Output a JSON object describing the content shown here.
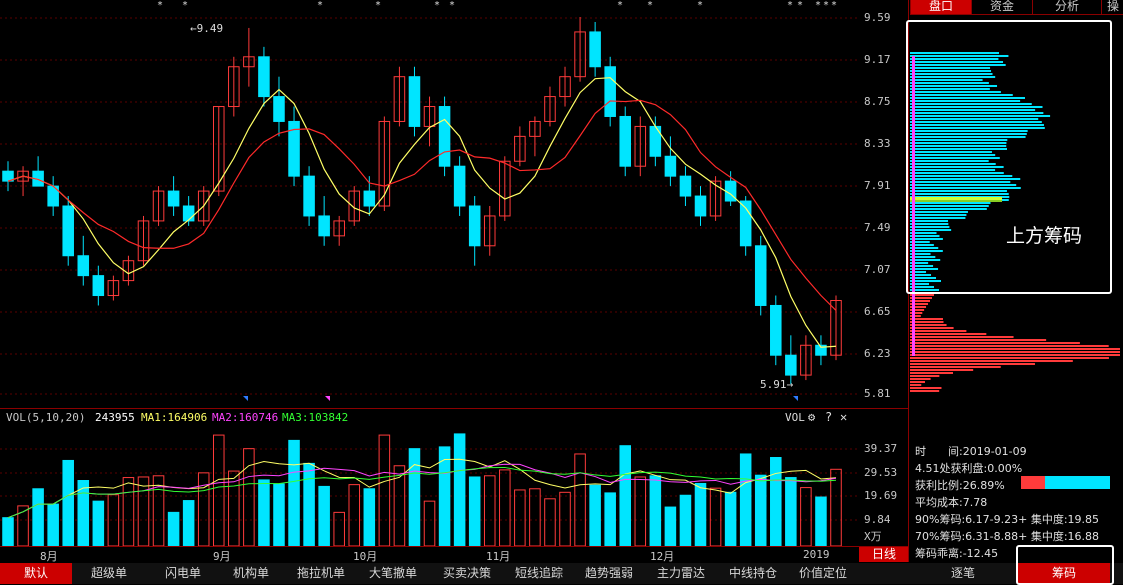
{
  "price_axis": [
    "9.59",
    "9.17",
    "8.75",
    "8.33",
    "7.91",
    "7.49",
    "7.07",
    "6.65",
    "6.23",
    "5.81"
  ],
  "annotations": {
    "high_label": "9.49",
    "low_label": "5.91"
  },
  "volume_header": {
    "indicator": "VOL(5,10,20)",
    "current": "243955",
    "ma1": "MA1:164906",
    "ma2": "MA2:160746",
    "ma3": "MA3:103842",
    "vol_label": "VOL"
  },
  "vol_axis": [
    "39.37",
    "29.53",
    "19.69",
    "9.84",
    "X万"
  ],
  "months": [
    "8月",
    "9月",
    "10月",
    "11月",
    "12月",
    "2019"
  ],
  "period_label": "日线",
  "right_tabs": [
    "盘口",
    "资金",
    "分析",
    "操"
  ],
  "chip_info": {
    "time": "时　　间:2019-01-09",
    "profit_at": "4.51处获利盘:0.00%",
    "profit_ratio": "获利比例:26.89%",
    "avg_cost": "平均成本:7.78",
    "c90": "90%筹码:6.17-9.23+ 集中度:19.85",
    "c70": "70%筹码:6.31-8.88+ 集中度:16.88",
    "deviation": "筹码乖离:-12.45"
  },
  "callout_text": "上方筹码",
  "bottom_tabs": [
    "默认",
    "超级单",
    "闪电单",
    "机构单",
    "拖拉机单",
    "大笔撤单",
    "买卖决策",
    "短线追踪",
    "趋势强弱",
    "主力雷达",
    "中线持仓",
    "价值定位"
  ],
  "right_bottom_tabs": [
    "逐笔",
    "筹码"
  ],
  "colors": {
    "up": "#ff3b3b",
    "down": "#00e5ff",
    "ma5": "#ffff66",
    "ma10": "#ff2a2a",
    "ma2": "#ff44ff",
    "ma3": "#33ff33",
    "accent": "#cc0000"
  },
  "chart_data": {
    "type": "candlestick",
    "y_range": [
      5.81,
      9.59
    ],
    "ohlc": [
      [
        8.05,
        8.15,
        7.85,
        7.95
      ],
      [
        7.95,
        8.1,
        7.8,
        8.05
      ],
      [
        8.05,
        8.2,
        7.9,
        7.9
      ],
      [
        7.9,
        8.0,
        7.6,
        7.7
      ],
      [
        7.7,
        7.8,
        7.1,
        7.2
      ],
      [
        7.2,
        7.4,
        6.9,
        7.0
      ],
      [
        7.0,
        7.1,
        6.7,
        6.8
      ],
      [
        6.8,
        7.0,
        6.75,
        6.95
      ],
      [
        6.95,
        7.2,
        6.9,
        7.15
      ],
      [
        7.15,
        7.6,
        7.1,
        7.55
      ],
      [
        7.55,
        7.9,
        7.5,
        7.85
      ],
      [
        7.85,
        8.0,
        7.6,
        7.7
      ],
      [
        7.7,
        7.8,
        7.5,
        7.55
      ],
      [
        7.55,
        7.9,
        7.5,
        7.85
      ],
      [
        7.85,
        8.7,
        7.8,
        8.7
      ],
      [
        8.7,
        9.2,
        8.6,
        9.1
      ],
      [
        9.1,
        9.49,
        8.9,
        9.2
      ],
      [
        9.2,
        9.3,
        8.7,
        8.8
      ],
      [
        8.8,
        9.0,
        8.4,
        8.55
      ],
      [
        8.55,
        8.7,
        7.9,
        8.0
      ],
      [
        8.0,
        8.1,
        7.5,
        7.6
      ],
      [
        7.6,
        7.8,
        7.3,
        7.4
      ],
      [
        7.4,
        7.6,
        7.3,
        7.55
      ],
      [
        7.55,
        7.9,
        7.5,
        7.85
      ],
      [
        7.85,
        8.0,
        7.6,
        7.7
      ],
      [
        7.7,
        8.6,
        7.65,
        8.55
      ],
      [
        8.55,
        9.1,
        8.5,
        9.0
      ],
      [
        9.0,
        9.1,
        8.4,
        8.5
      ],
      [
        8.5,
        8.8,
        8.3,
        8.7
      ],
      [
        8.7,
        8.8,
        8.0,
        8.1
      ],
      [
        8.1,
        8.2,
        7.6,
        7.7
      ],
      [
        7.7,
        7.8,
        7.1,
        7.3
      ],
      [
        7.3,
        7.7,
        7.2,
        7.6
      ],
      [
        7.6,
        8.2,
        7.55,
        8.15
      ],
      [
        8.15,
        8.5,
        8.1,
        8.4
      ],
      [
        8.4,
        8.6,
        8.2,
        8.55
      ],
      [
        8.55,
        8.9,
        8.5,
        8.8
      ],
      [
        8.8,
        9.1,
        8.7,
        9.0
      ],
      [
        9.0,
        9.6,
        8.95,
        9.45
      ],
      [
        9.45,
        9.55,
        9.0,
        9.1
      ],
      [
        9.1,
        9.2,
        8.5,
        8.6
      ],
      [
        8.6,
        8.7,
        8.0,
        8.1
      ],
      [
        8.1,
        8.6,
        8.0,
        8.5
      ],
      [
        8.5,
        8.6,
        8.1,
        8.2
      ],
      [
        8.2,
        8.4,
        7.9,
        8.0
      ],
      [
        8.0,
        8.1,
        7.7,
        7.8
      ],
      [
        7.8,
        7.9,
        7.5,
        7.6
      ],
      [
        7.6,
        8.0,
        7.55,
        7.95
      ],
      [
        7.95,
        8.05,
        7.7,
        7.75
      ],
      [
        7.75,
        7.8,
        7.2,
        7.3
      ],
      [
        7.3,
        7.4,
        6.6,
        6.7
      ],
      [
        6.7,
        6.8,
        6.1,
        6.2
      ],
      [
        6.2,
        6.4,
        5.91,
        6.0
      ],
      [
        6.0,
        6.4,
        5.95,
        6.3
      ],
      [
        6.3,
        6.4,
        6.1,
        6.2
      ],
      [
        6.2,
        6.8,
        6.15,
        6.75
      ]
    ]
  }
}
